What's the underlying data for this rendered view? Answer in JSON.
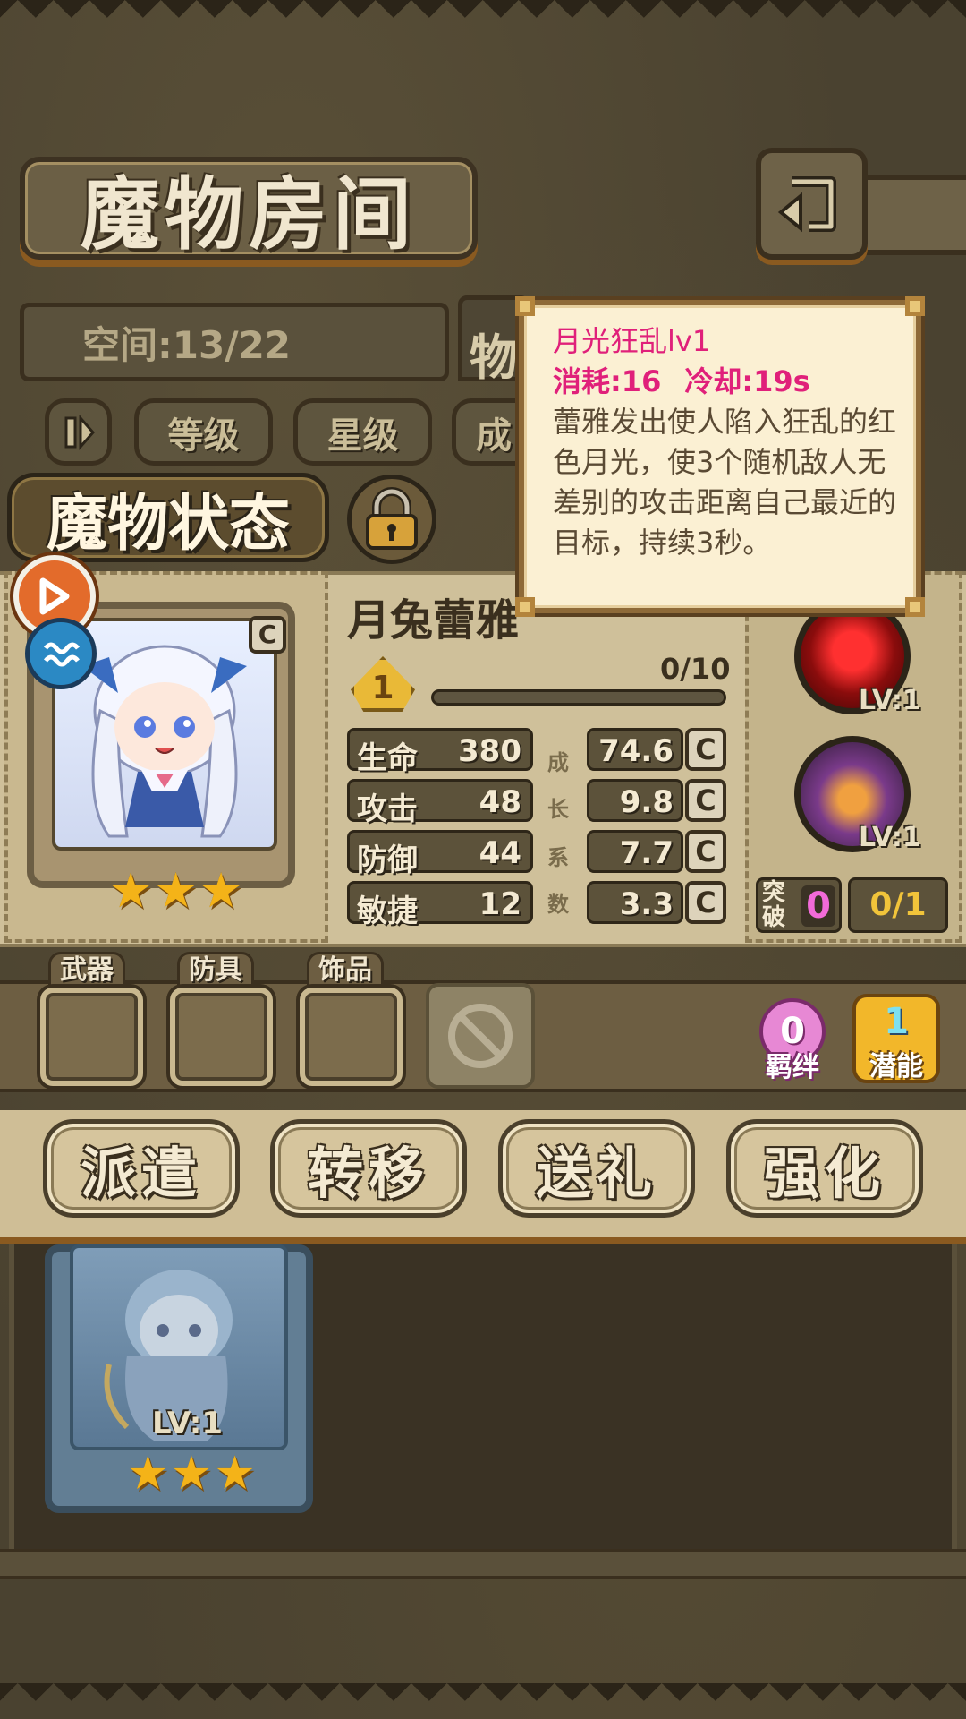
{
  "header": {
    "title": "魔物房间"
  },
  "storage": {
    "space_label": "空间:13/22",
    "tab_partial": "物"
  },
  "filters": [
    "等级",
    "星级",
    "成"
  ],
  "status": {
    "title": "魔物状态"
  },
  "monster": {
    "name": "月兔蕾雅",
    "level": "1",
    "exp": "0/10",
    "exp_fraction": 0.0,
    "star_count": 3,
    "grade": "C",
    "element_icon": "water-icon",
    "class_icon": "rogue-class-icon",
    "stats": [
      {
        "label": "生命",
        "value": "380",
        "growth": "74.6",
        "grade": "C"
      },
      {
        "label": "攻击",
        "value": "48",
        "growth": "9.8",
        "grade": "C"
      },
      {
        "label": "防御",
        "value": "44",
        "growth": "7.7",
        "grade": "C"
      },
      {
        "label": "敏捷",
        "value": "12",
        "growth": "3.3",
        "grade": "C"
      }
    ],
    "growth_label": [
      "成",
      "长",
      "系",
      "数"
    ]
  },
  "skills": [
    {
      "icon": "blood-moon-icon",
      "level": "LV:1"
    },
    {
      "icon": "power-fist-icon",
      "level": "LV:1"
    }
  ],
  "breakthrough": {
    "label": "突破",
    "value": "0",
    "count": "0/1"
  },
  "equipment": {
    "slots": [
      "武器",
      "防具",
      "饰品"
    ],
    "locked_icon": "forbidden-icon"
  },
  "bond": {
    "value": "0",
    "label": "羁绊"
  },
  "potential": {
    "value": "1",
    "label": "潜能"
  },
  "actions": [
    "派遣",
    "转移",
    "送礼",
    "强化"
  ],
  "inventory": {
    "card_level": "LV:1",
    "star_count": 3
  },
  "tooltip": {
    "title": "月光狂乱lv1",
    "cost": "消耗:16",
    "cooldown": "冷却:19s",
    "description": "蕾雅发出使人陷入狂乱的红色月光，使3个随机敌人无差别的攻击距离自己最近的目标，持续3秒。"
  },
  "colors": {
    "accent": "#e0207a",
    "gold": "#f4b318",
    "bond_pink": "#e788d4"
  }
}
